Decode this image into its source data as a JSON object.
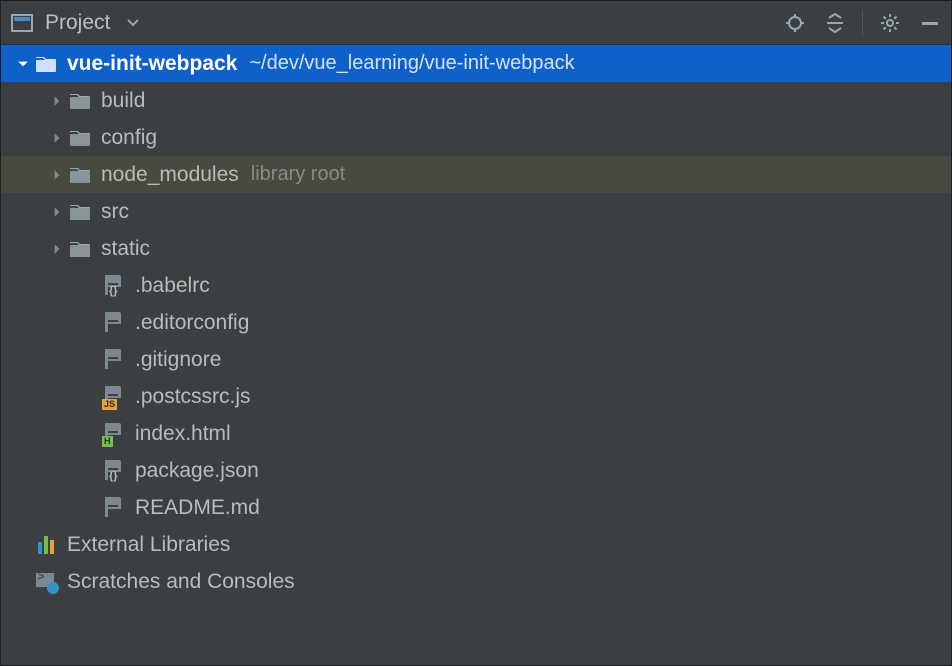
{
  "toolbar": {
    "title": "Project"
  },
  "tree": [
    {
      "depth": 0,
      "expand": "down",
      "icon": "folder",
      "label": "vue-init-webpack",
      "bold": true,
      "note": "~/dev/vue_learning/vue-init-webpack",
      "state": "selected"
    },
    {
      "depth": 1,
      "expand": "right",
      "icon": "folder",
      "label": "build"
    },
    {
      "depth": 1,
      "expand": "right",
      "icon": "folder",
      "label": "config"
    },
    {
      "depth": 1,
      "expand": "right",
      "icon": "folder",
      "label": "node_modules",
      "note": "library root",
      "state": "highlight"
    },
    {
      "depth": 1,
      "expand": "right",
      "icon": "folder",
      "label": "src"
    },
    {
      "depth": 1,
      "expand": "right",
      "icon": "folder",
      "label": "static"
    },
    {
      "depth": 2,
      "expand": "none",
      "icon": "file-json",
      "label": ".babelrc"
    },
    {
      "depth": 2,
      "expand": "none",
      "icon": "file-text",
      "label": ".editorconfig"
    },
    {
      "depth": 2,
      "expand": "none",
      "icon": "file-text",
      "label": ".gitignore"
    },
    {
      "depth": 2,
      "expand": "none",
      "icon": "file-js",
      "label": ".postcssrc.js"
    },
    {
      "depth": 2,
      "expand": "none",
      "icon": "file-html",
      "label": "index.html"
    },
    {
      "depth": 2,
      "expand": "none",
      "icon": "file-json",
      "label": "package.json"
    },
    {
      "depth": 2,
      "expand": "none",
      "icon": "file-text",
      "label": "README.md"
    },
    {
      "depth": 0,
      "expand": "none",
      "icon": "libraries",
      "label": "External Libraries"
    },
    {
      "depth": 0,
      "expand": "none",
      "icon": "scratches",
      "label": "Scratches and Consoles"
    }
  ]
}
